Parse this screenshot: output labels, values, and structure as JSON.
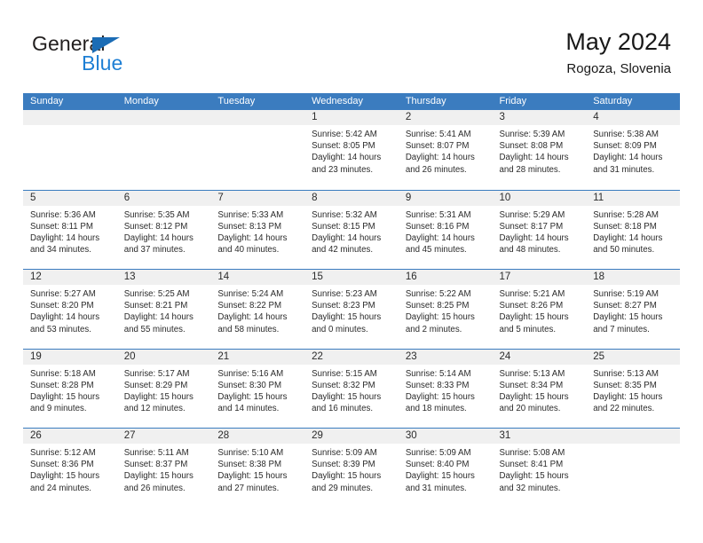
{
  "brand": {
    "name_part1": "General",
    "name_part2": "Blue",
    "triangle_icon": "triangle-icon",
    "blue": "#1E7FD4",
    "dark": "#221F1F"
  },
  "header": {
    "title": "May 2024",
    "subtitle": "Rogoza, Slovenia"
  },
  "theme": {
    "header_blue": "#3B7CBF",
    "day_band_grey": "#F0F0F0",
    "text": "#2B2B2B"
  },
  "weekdays": [
    "Sunday",
    "Monday",
    "Tuesday",
    "Wednesday",
    "Thursday",
    "Friday",
    "Saturday"
  ],
  "weeks": [
    [
      {
        "empty": true
      },
      {
        "empty": true
      },
      {
        "empty": true
      },
      {
        "day": "1",
        "sunrise": "Sunrise: 5:42 AM",
        "sunset": "Sunset: 8:05 PM",
        "daylight1": "Daylight: 14 hours",
        "daylight2": "and 23 minutes."
      },
      {
        "day": "2",
        "sunrise": "Sunrise: 5:41 AM",
        "sunset": "Sunset: 8:07 PM",
        "daylight1": "Daylight: 14 hours",
        "daylight2": "and 26 minutes."
      },
      {
        "day": "3",
        "sunrise": "Sunrise: 5:39 AM",
        "sunset": "Sunset: 8:08 PM",
        "daylight1": "Daylight: 14 hours",
        "daylight2": "and 28 minutes."
      },
      {
        "day": "4",
        "sunrise": "Sunrise: 5:38 AM",
        "sunset": "Sunset: 8:09 PM",
        "daylight1": "Daylight: 14 hours",
        "daylight2": "and 31 minutes."
      }
    ],
    [
      {
        "day": "5",
        "sunrise": "Sunrise: 5:36 AM",
        "sunset": "Sunset: 8:11 PM",
        "daylight1": "Daylight: 14 hours",
        "daylight2": "and 34 minutes."
      },
      {
        "day": "6",
        "sunrise": "Sunrise: 5:35 AM",
        "sunset": "Sunset: 8:12 PM",
        "daylight1": "Daylight: 14 hours",
        "daylight2": "and 37 minutes."
      },
      {
        "day": "7",
        "sunrise": "Sunrise: 5:33 AM",
        "sunset": "Sunset: 8:13 PM",
        "daylight1": "Daylight: 14 hours",
        "daylight2": "and 40 minutes."
      },
      {
        "day": "8",
        "sunrise": "Sunrise: 5:32 AM",
        "sunset": "Sunset: 8:15 PM",
        "daylight1": "Daylight: 14 hours",
        "daylight2": "and 42 minutes."
      },
      {
        "day": "9",
        "sunrise": "Sunrise: 5:31 AM",
        "sunset": "Sunset: 8:16 PM",
        "daylight1": "Daylight: 14 hours",
        "daylight2": "and 45 minutes."
      },
      {
        "day": "10",
        "sunrise": "Sunrise: 5:29 AM",
        "sunset": "Sunset: 8:17 PM",
        "daylight1": "Daylight: 14 hours",
        "daylight2": "and 48 minutes."
      },
      {
        "day": "11",
        "sunrise": "Sunrise: 5:28 AM",
        "sunset": "Sunset: 8:18 PM",
        "daylight1": "Daylight: 14 hours",
        "daylight2": "and 50 minutes."
      }
    ],
    [
      {
        "day": "12",
        "sunrise": "Sunrise: 5:27 AM",
        "sunset": "Sunset: 8:20 PM",
        "daylight1": "Daylight: 14 hours",
        "daylight2": "and 53 minutes."
      },
      {
        "day": "13",
        "sunrise": "Sunrise: 5:25 AM",
        "sunset": "Sunset: 8:21 PM",
        "daylight1": "Daylight: 14 hours",
        "daylight2": "and 55 minutes."
      },
      {
        "day": "14",
        "sunrise": "Sunrise: 5:24 AM",
        "sunset": "Sunset: 8:22 PM",
        "daylight1": "Daylight: 14 hours",
        "daylight2": "and 58 minutes."
      },
      {
        "day": "15",
        "sunrise": "Sunrise: 5:23 AM",
        "sunset": "Sunset: 8:23 PM",
        "daylight1": "Daylight: 15 hours",
        "daylight2": "and 0 minutes."
      },
      {
        "day": "16",
        "sunrise": "Sunrise: 5:22 AM",
        "sunset": "Sunset: 8:25 PM",
        "daylight1": "Daylight: 15 hours",
        "daylight2": "and 2 minutes."
      },
      {
        "day": "17",
        "sunrise": "Sunrise: 5:21 AM",
        "sunset": "Sunset: 8:26 PM",
        "daylight1": "Daylight: 15 hours",
        "daylight2": "and 5 minutes."
      },
      {
        "day": "18",
        "sunrise": "Sunrise: 5:19 AM",
        "sunset": "Sunset: 8:27 PM",
        "daylight1": "Daylight: 15 hours",
        "daylight2": "and 7 minutes."
      }
    ],
    [
      {
        "day": "19",
        "sunrise": "Sunrise: 5:18 AM",
        "sunset": "Sunset: 8:28 PM",
        "daylight1": "Daylight: 15 hours",
        "daylight2": "and 9 minutes."
      },
      {
        "day": "20",
        "sunrise": "Sunrise: 5:17 AM",
        "sunset": "Sunset: 8:29 PM",
        "daylight1": "Daylight: 15 hours",
        "daylight2": "and 12 minutes."
      },
      {
        "day": "21",
        "sunrise": "Sunrise: 5:16 AM",
        "sunset": "Sunset: 8:30 PM",
        "daylight1": "Daylight: 15 hours",
        "daylight2": "and 14 minutes."
      },
      {
        "day": "22",
        "sunrise": "Sunrise: 5:15 AM",
        "sunset": "Sunset: 8:32 PM",
        "daylight1": "Daylight: 15 hours",
        "daylight2": "and 16 minutes."
      },
      {
        "day": "23",
        "sunrise": "Sunrise: 5:14 AM",
        "sunset": "Sunset: 8:33 PM",
        "daylight1": "Daylight: 15 hours",
        "daylight2": "and 18 minutes."
      },
      {
        "day": "24",
        "sunrise": "Sunrise: 5:13 AM",
        "sunset": "Sunset: 8:34 PM",
        "daylight1": "Daylight: 15 hours",
        "daylight2": "and 20 minutes."
      },
      {
        "day": "25",
        "sunrise": "Sunrise: 5:13 AM",
        "sunset": "Sunset: 8:35 PM",
        "daylight1": "Daylight: 15 hours",
        "daylight2": "and 22 minutes."
      }
    ],
    [
      {
        "day": "26",
        "sunrise": "Sunrise: 5:12 AM",
        "sunset": "Sunset: 8:36 PM",
        "daylight1": "Daylight: 15 hours",
        "daylight2": "and 24 minutes."
      },
      {
        "day": "27",
        "sunrise": "Sunrise: 5:11 AM",
        "sunset": "Sunset: 8:37 PM",
        "daylight1": "Daylight: 15 hours",
        "daylight2": "and 26 minutes."
      },
      {
        "day": "28",
        "sunrise": "Sunrise: 5:10 AM",
        "sunset": "Sunset: 8:38 PM",
        "daylight1": "Daylight: 15 hours",
        "daylight2": "and 27 minutes."
      },
      {
        "day": "29",
        "sunrise": "Sunrise: 5:09 AM",
        "sunset": "Sunset: 8:39 PM",
        "daylight1": "Daylight: 15 hours",
        "daylight2": "and 29 minutes."
      },
      {
        "day": "30",
        "sunrise": "Sunrise: 5:09 AM",
        "sunset": "Sunset: 8:40 PM",
        "daylight1": "Daylight: 15 hours",
        "daylight2": "and 31 minutes."
      },
      {
        "day": "31",
        "sunrise": "Sunrise: 5:08 AM",
        "sunset": "Sunset: 8:41 PM",
        "daylight1": "Daylight: 15 hours",
        "daylight2": "and 32 minutes."
      },
      {
        "empty": true
      }
    ]
  ]
}
